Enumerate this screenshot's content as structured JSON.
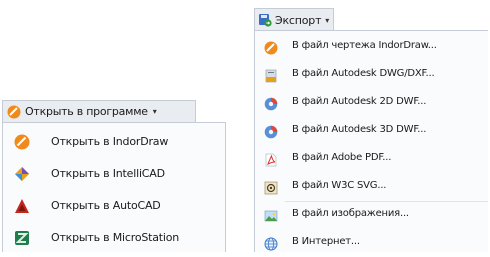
{
  "export_menu": {
    "button_label": "Экспорт",
    "items": [
      {
        "label": "В файл чертежа IndorDraw...",
        "icon": "indordraw-icon"
      },
      {
        "label": "В файл Autodesk DWG/DXF...",
        "icon": "dwg-file-icon"
      },
      {
        "label": "В файл Autodesk 2D DWF...",
        "icon": "dwf-2d-icon"
      },
      {
        "label": "В файл Autodesk 3D DWF...",
        "icon": "dwf-3d-icon"
      },
      {
        "label": "В файл Adobe PDF...",
        "icon": "pdf-icon"
      },
      {
        "label": "В файл W3C SVG...",
        "icon": "svg-icon"
      },
      {
        "label": "В файл изображения...",
        "icon": "image-icon"
      },
      {
        "label": "В Интернет...",
        "icon": "globe-icon"
      }
    ]
  },
  "open_menu": {
    "button_label": "Открыть в программе",
    "items": [
      {
        "label": "Открыть в IndorDraw",
        "icon": "indordraw-icon"
      },
      {
        "label": "Открыть в IntelliCAD",
        "icon": "intellicad-icon"
      },
      {
        "label": "Открыть в AutoCAD",
        "icon": "autocad-icon"
      },
      {
        "label": "Открыть в MicroStation",
        "icon": "microstation-icon"
      }
    ]
  },
  "colors": {
    "accent_orange": "#f08a1c",
    "border": "#c5ccd6",
    "header_bg": "#e9ecf1"
  }
}
